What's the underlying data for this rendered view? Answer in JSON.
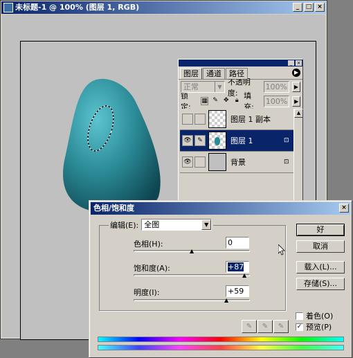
{
  "window": {
    "title": "未标题-1 @ 100% (图层 1, RGB)",
    "min": "_",
    "max": "□",
    "close": "×"
  },
  "colors": {
    "title_bar": "#0a246a",
    "shape_teal": "#2a8a96",
    "selection": "#0a246a"
  },
  "layers_panel": {
    "tabs": [
      {
        "label": "图层"
      },
      {
        "label": "通道"
      },
      {
        "label": "路径"
      }
    ],
    "blend_mode": "正常",
    "opacity_label": "不透明度:",
    "opacity_value": "100%",
    "lock_label": "锁定:",
    "fill_label": "填充:",
    "fill_value": "100%",
    "layers": [
      {
        "name": "图层 1 副本"
      },
      {
        "name": "图层 1"
      },
      {
        "name": "背景"
      }
    ]
  },
  "dialog": {
    "title": "色相/饱和度",
    "close": "×",
    "edit_label": "编辑(E):",
    "edit_value": "全图",
    "hue_label": "色相(H):",
    "hue_value": "0",
    "sat_label": "饱和度(A):",
    "sat_value": "+87",
    "light_label": "明度(I):",
    "light_value": "+59",
    "ok": "好",
    "cancel": "取消",
    "load": "载入(L)...",
    "save": "存储(S)...",
    "colorize_label": "着色(O)",
    "preview_label": "预览(P)",
    "colorize_checked": false,
    "preview_checked": true
  }
}
